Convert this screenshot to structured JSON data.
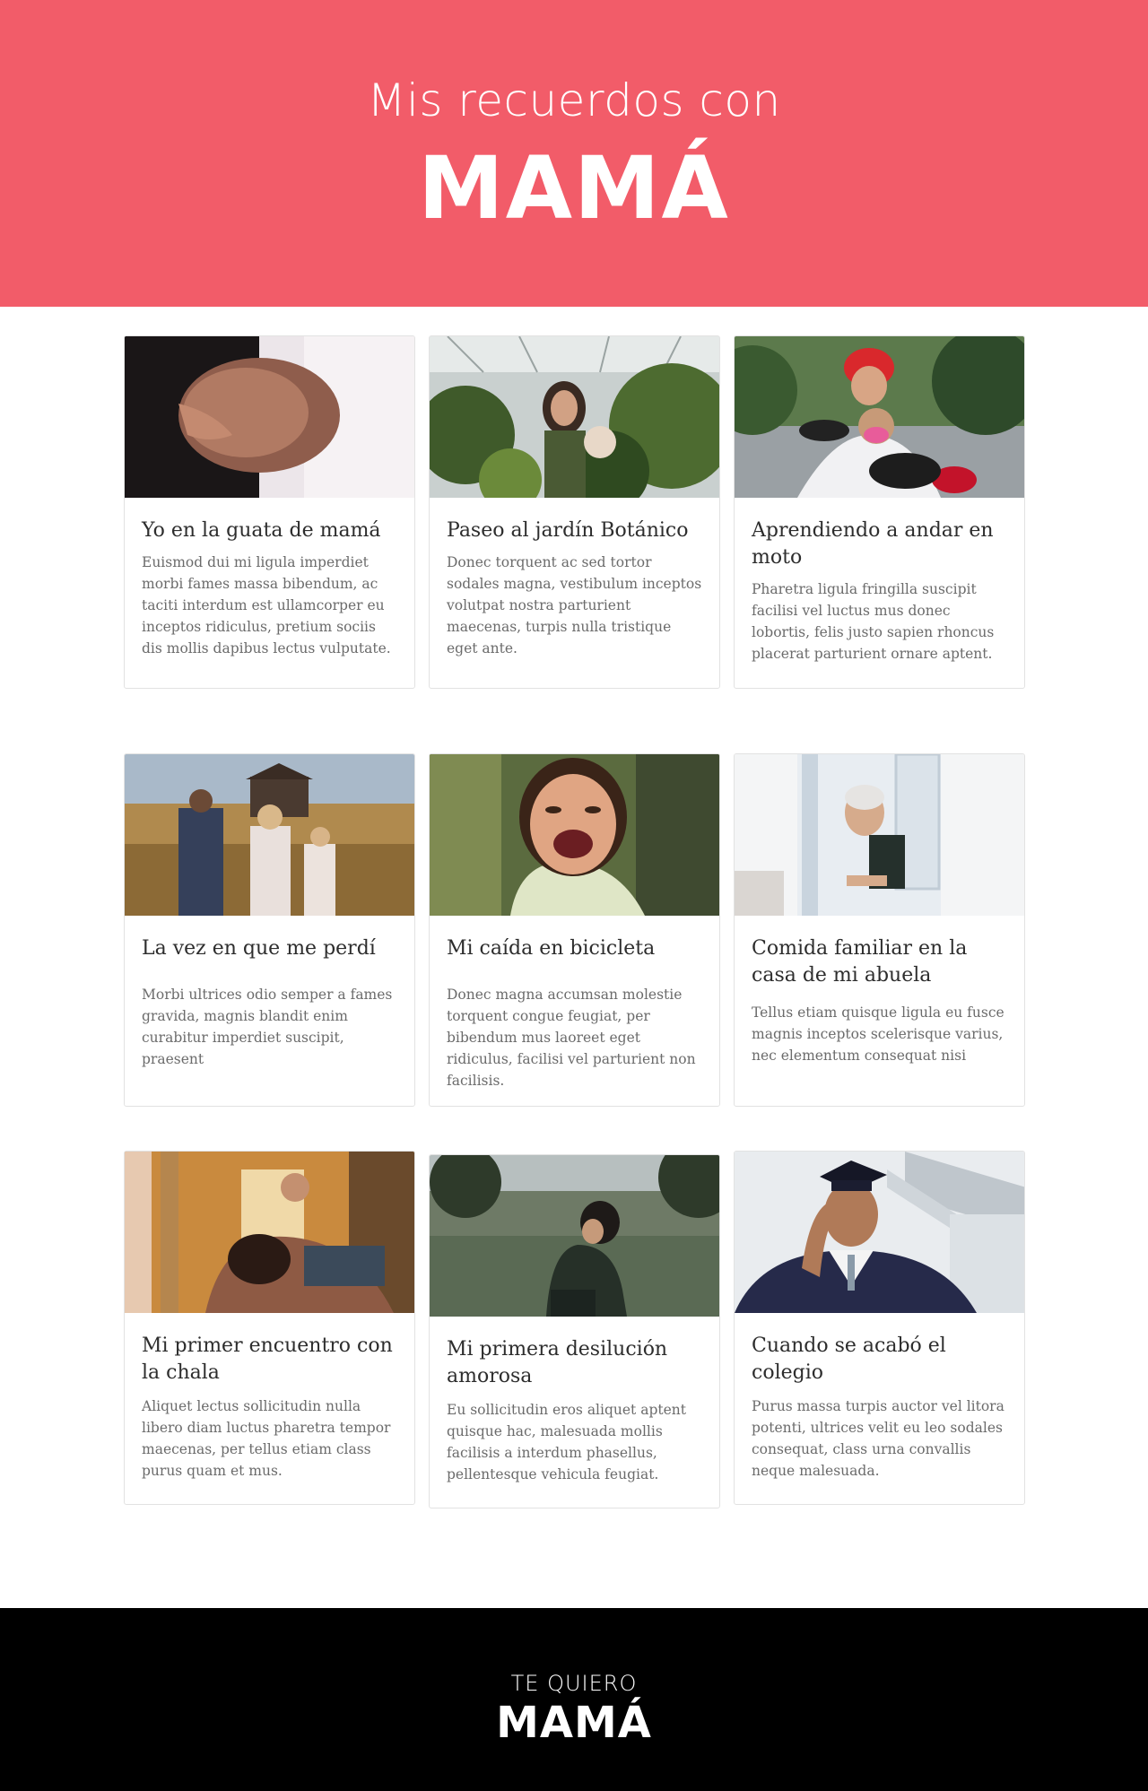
{
  "header": {
    "subtitle": "Mis recuerdos con",
    "title": "MAMÁ"
  },
  "cards": [
    {
      "title": "Yo en la guata de mamá",
      "text": "Euismod dui mi ligula imperdiet morbi fames massa bibendum, ac taciti interdum est ullamcorper eu inceptos ridiculus, pretium sociis dis mollis dapibus lectus vulputate."
    },
    {
      "title": "Paseo al jardín Botánico",
      "text": "Donec torquent ac sed tortor sodales magna, vestibulum inceptos volutpat nostra parturient maecenas, turpis nulla tristique eget ante."
    },
    {
      "title": "Aprendiendo a andar en moto",
      "text": "Pharetra ligula fringilla suscipit facilisi vel luctus mus donec lobortis, felis justo sapien rhoncus placerat parturient ornare aptent."
    },
    {
      "title": "La vez en que me perdí",
      "text": "Morbi ultrices odio semper a fames gravida, magnis blandit enim curabitur imperdiet suscipit, praesent"
    },
    {
      "title": "Mi caída en bicicleta",
      "text": "Donec magna accumsan molestie torquent congue feugiat, per bibendum mus laoreet eget ridiculus, facilisi vel parturient non facilisis."
    },
    {
      "title": "Comida familiar en la casa de mi abuela",
      "text": "Tellus etiam quisque ligula eu fusce magnis inceptos scelerisque varius, nec elementum consequat nisi"
    },
    {
      "title": "Mi primer encuentro con la chala",
      "text": "Aliquet lectus sollicitudin nulla libero diam luctus pharetra tempor maecenas, per tellus etiam class purus quam et mus."
    },
    {
      "title": "Mi primera desilución amorosa",
      "text": "Eu sollicitudin eros aliquet aptent quisque hac, malesuada mollis facilisis a interdum phasellus, pellentesque vehicula feugiat."
    },
    {
      "title": "Cuando se acabó el colegio",
      "text": "Purus massa turpis auctor vel litora potenti, ultrices velit eu leo sodales consequat, class urna convallis neque malesuada."
    }
  ],
  "footer": {
    "small": "TE QUIERO",
    "big": "MAMÁ"
  },
  "colors": {
    "hero_background": "#f25c69",
    "footer_background": "#000000"
  }
}
